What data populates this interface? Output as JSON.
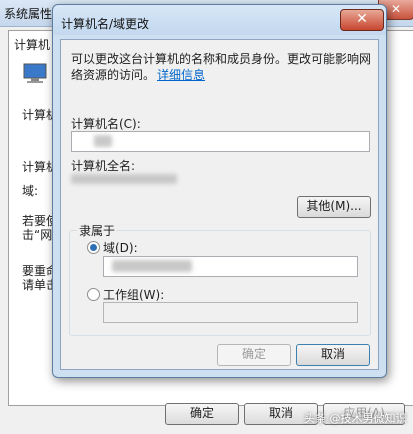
{
  "background_window": {
    "title": "系统属性",
    "close_glyph": "✕",
    "tab_label": "计算机",
    "fragments": [
      "计算机",
      "计算机",
      "域:",
      "若要使",
      "击“网",
      "要重命",
      "请单击"
    ],
    "buttons": {
      "ok": "确定",
      "cancel": "取消",
      "apply": "应用(A)"
    }
  },
  "dialog": {
    "title": "计算机名/域更改",
    "close_glyph": "✕",
    "description_line1": "可以更改这台计算机的名称和成员身份。更改可能影响网",
    "description_line2": "络资源的访问。",
    "details_link": "详细信息",
    "computer_name_label": "计算机名(C):",
    "computer_name_value": "",
    "full_name_label": "计算机全名:",
    "more_button": "其他(M)...",
    "member_of_label": "隶属于",
    "domain_label": "域(D):",
    "domain_selected": true,
    "workgroup_label": "工作组(W):",
    "workgroup_selected": false,
    "ok_button": "确定",
    "cancel_button": "取消"
  },
  "watermark": "头条 @技术男微知识"
}
